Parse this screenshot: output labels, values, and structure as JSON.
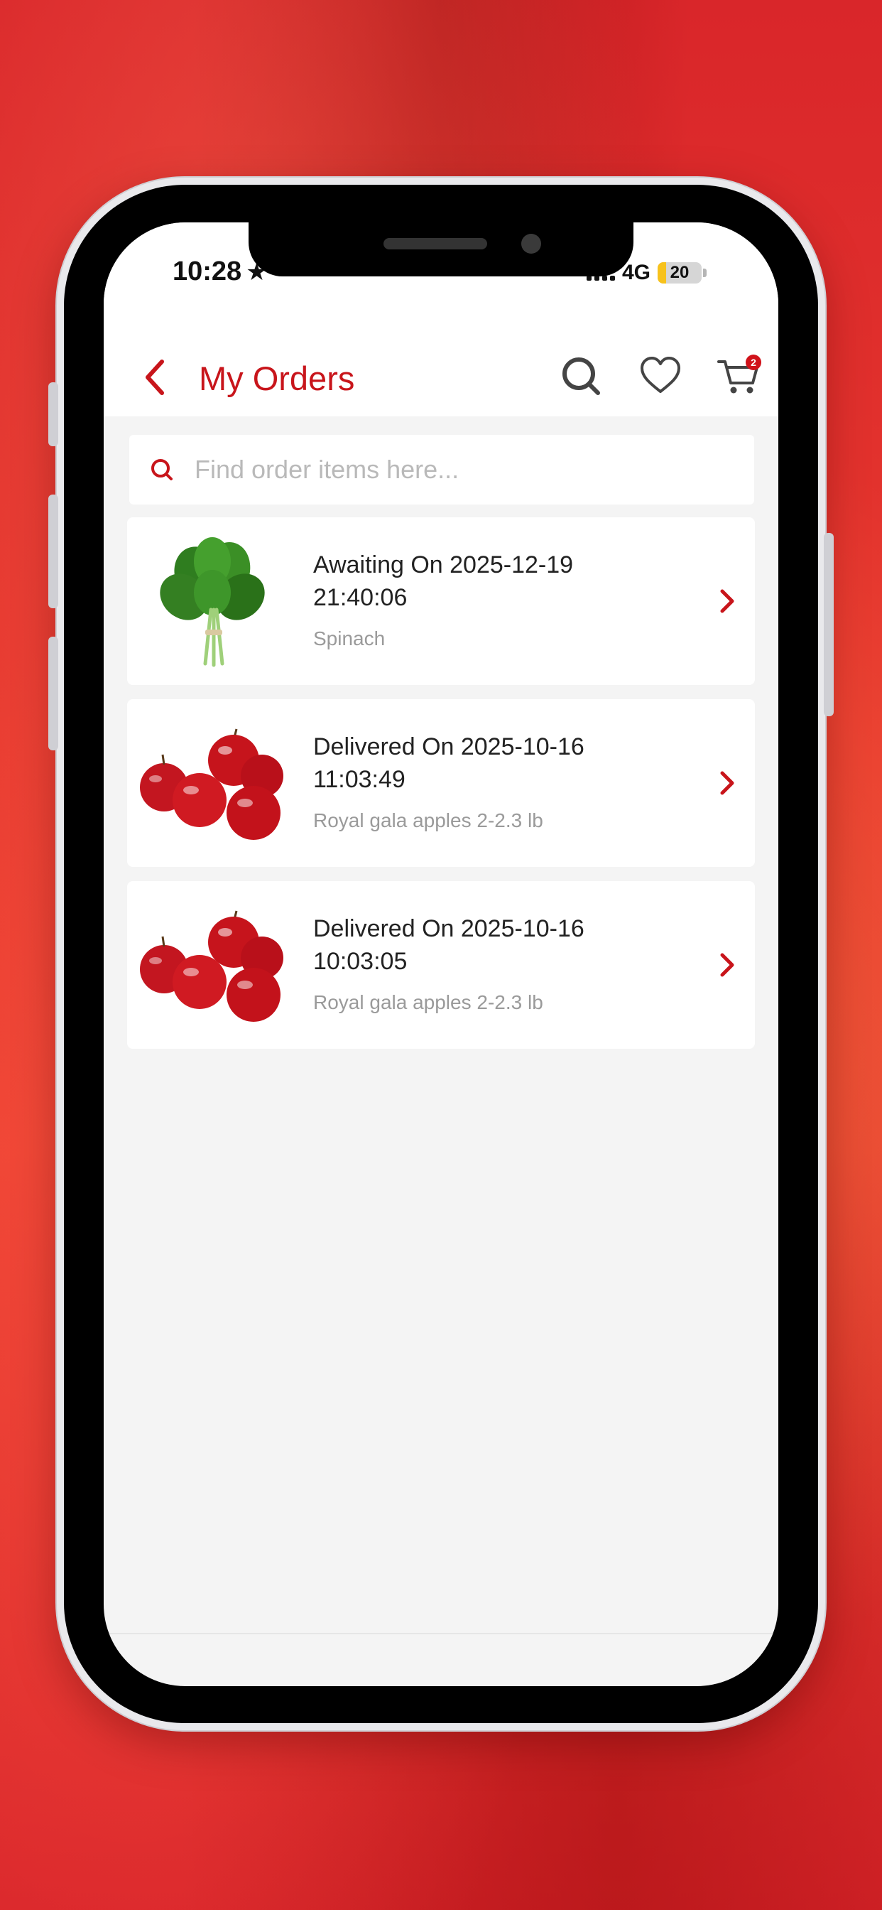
{
  "status_bar": {
    "time": "10:28",
    "network": "4G",
    "battery": "20",
    "battery_level": 0.2
  },
  "header": {
    "title": "My Orders",
    "cart_count": "2"
  },
  "search": {
    "placeholder": "Find order items here..."
  },
  "orders": [
    {
      "status_line": "Awaiting On 2025-12-19",
      "time_line": "21:40:06",
      "item": "Spinach",
      "thumb": "spinach-image"
    },
    {
      "status_line": "Delivered On 2025-10-16",
      "time_line": "11:03:49",
      "item": "Royal gala apples 2-2.3 lb",
      "thumb": "apples-image"
    },
    {
      "status_line": "Delivered On 2025-10-16",
      "time_line": "10:03:05",
      "item": "Royal gala apples 2-2.3 lb",
      "thumb": "apples-image"
    }
  ],
  "colors": {
    "brand": "#c8151b",
    "background": "#f4f4f4",
    "card": "#ffffff",
    "muted_text": "#9a9a9a"
  }
}
